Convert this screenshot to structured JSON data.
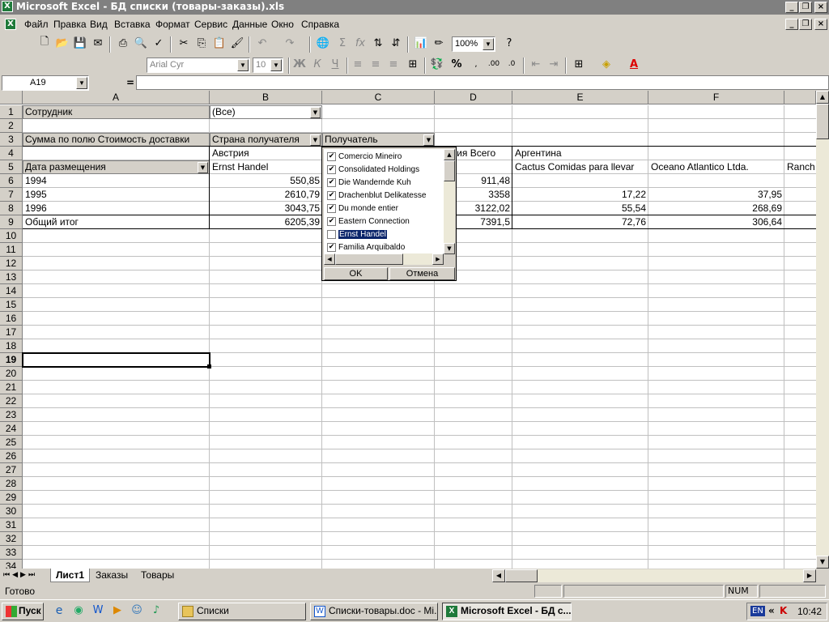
{
  "window": {
    "title": "Microsoft Excel - БД списки (товары-заказы).xls"
  },
  "menu": [
    "Файл",
    "Правка",
    "Вид",
    "Вставка",
    "Формат",
    "Сервис",
    "Данные",
    "Окно",
    "Справка"
  ],
  "toolbar": {
    "zoom": "100%",
    "font": "Arial Cyr",
    "font_size": "10"
  },
  "formula_bar": {
    "name_box": "A19",
    "equals": "="
  },
  "columns": [
    "A",
    "B",
    "C",
    "D",
    "E",
    "F"
  ],
  "rows": [
    "1",
    "2",
    "3",
    "4",
    "5",
    "6",
    "7",
    "8",
    "9",
    "10",
    "11",
    "12",
    "13",
    "14",
    "15",
    "16",
    "17",
    "18",
    "19",
    "20",
    "21",
    "22",
    "23",
    "24",
    "25",
    "26",
    "27",
    "28",
    "29",
    "30",
    "31",
    "32",
    "33",
    "34"
  ],
  "cells": {
    "a1": "Сотрудник",
    "b1": "(Все)",
    "a3": "Сумма по полю Стоимость доставки",
    "b3": "Страна получателя",
    "c3": "Получатель",
    "b4": "Австрия",
    "d4": "трия Всего",
    "e4": "Аргентина",
    "a5": "Дата размещения",
    "b5": "Ernst Handel",
    "e5": "Cactus Comidas para llevar",
    "f5": "Oceano Atlantico Ltda.",
    "g5": "Ranch",
    "a6": "1994",
    "b6": "550,85",
    "d6": "911,48",
    "a7": "1995",
    "b7": "2610,79",
    "d7": "3358",
    "e7": "17,22",
    "f7": "37,95",
    "a8": "1996",
    "b8": "3043,75",
    "d8": "3122,02",
    "e8": "55,54",
    "f8": "268,69",
    "a9": "Общий итог",
    "b9": "6205,39",
    "d9": "7391,5",
    "e9": "72,76",
    "f9": "306,64"
  },
  "dropdown": {
    "items": [
      {
        "label": "Comercio Mineiro",
        "checked": true
      },
      {
        "label": "Consolidated Holdings",
        "checked": true
      },
      {
        "label": "Die Wandernde Kuh",
        "checked": true
      },
      {
        "label": "Drachenblut Delikatesse",
        "checked": true
      },
      {
        "label": "Du monde entier",
        "checked": true
      },
      {
        "label": "Eastern Connection",
        "checked": true
      },
      {
        "label": "Ernst Handel",
        "checked": false
      },
      {
        "label": "Familia Arquibaldo",
        "checked": true
      }
    ],
    "ok": "OK",
    "cancel": "Отмена"
  },
  "sheets": [
    "Лист1",
    "Заказы",
    "Товары"
  ],
  "status": {
    "ready": "Готово",
    "num": "NUM"
  },
  "taskbar": {
    "start": "Пуск",
    "tasks": [
      "Списки",
      "Списки-товары.doc - Mi...",
      "Microsoft Excel - БД с..."
    ],
    "lang": "EN",
    "time": "10:42"
  }
}
